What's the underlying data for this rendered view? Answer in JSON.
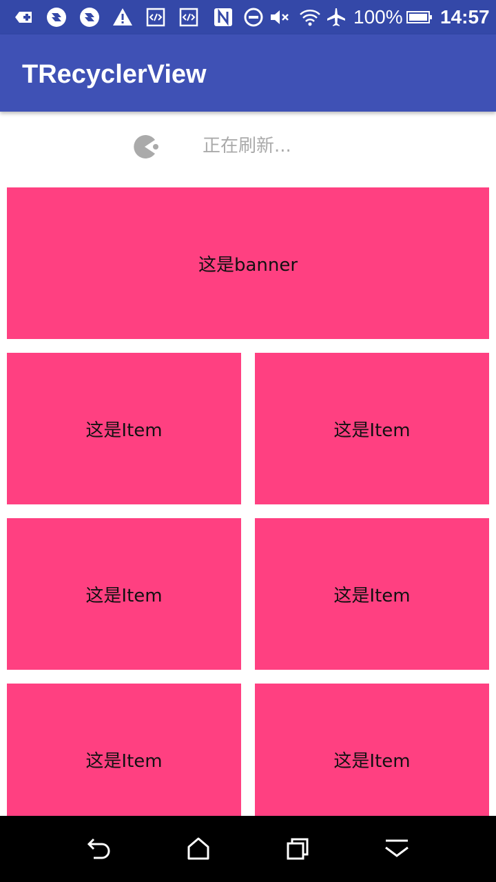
{
  "status_bar": {
    "icons": [
      "add-notification-icon",
      "sync-icon",
      "sync-icon",
      "warning-icon",
      "code-icon",
      "code-icon",
      "nfc-icon",
      "do-not-disturb-icon",
      "volume-mute-icon",
      "wifi-icon",
      "airplane-icon",
      "battery-icon"
    ],
    "battery": "100%",
    "time": "14:57",
    "background": "#3448a8"
  },
  "app_bar": {
    "title": "TRecyclerView",
    "background": "#3f51b5"
  },
  "refresh": {
    "text": "正在刷新...",
    "icon": "pacman-icon",
    "text_color": "#aaaaaa"
  },
  "content": {
    "banner_label": "这是banner",
    "items": [
      {
        "label": "这是Item"
      },
      {
        "label": "这是Item"
      },
      {
        "label": "这是Item"
      },
      {
        "label": "这是Item"
      },
      {
        "label": "这是Item"
      },
      {
        "label": "这是Item"
      }
    ],
    "card_color": "#ff4081"
  },
  "nav_bar": {
    "buttons": [
      "back-icon",
      "home-icon",
      "recents-icon",
      "collapse-icon"
    ]
  }
}
